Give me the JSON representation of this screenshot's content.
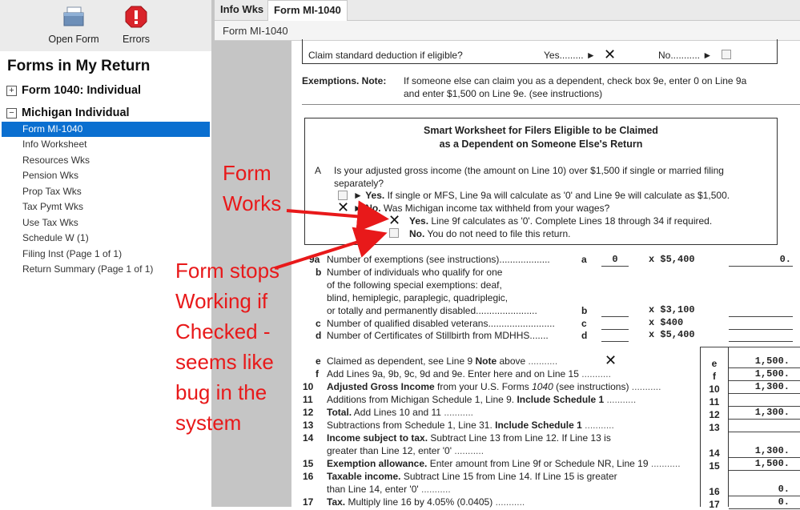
{
  "toolbar": {
    "open_form": "Open Form",
    "errors": "Errors"
  },
  "sidebar": {
    "title": "Forms in My Return",
    "groups": [
      {
        "label": "Form 1040:  Individual"
      },
      {
        "label": "Michigan Individual"
      }
    ],
    "items": [
      "Form MI-1040",
      "Info Worksheet",
      "Resources Wks",
      "Pension Wks",
      "Prop Tax Wks",
      "Tax Pymt Wks",
      "Use Tax Wks",
      "Schedule W (1)",
      "Filing Inst (Page 1 of 1)",
      "Return Summary (Page 1 of 1)"
    ]
  },
  "tabs": [
    "Info Wks",
    "Form MI-1040"
  ],
  "subtitle": "Form MI-1040",
  "form": {
    "std_ded": {
      "label": "Claim standard deduction if eligible?",
      "yes": "Yes",
      "no": "No"
    },
    "exemptions": {
      "head": "Exemptions. Note:",
      "line1": "If someone else can claim you as a dependent, check box 9e, enter 0 on Line 9a",
      "line2": "and enter $1,500 on Line 9e. (see instructions)"
    },
    "smart": {
      "title1": "Smart Worksheet for Filers Eligible to be Claimed",
      "title2": "as a Dependent on Someone Else's Return",
      "a": "A",
      "q1": "Is your adjusted gross income (the amount on Line 10) over $1,500 if single or married filing",
      "q2": "separately?",
      "yes_label": "Yes.",
      "yes_text": "If single or MFS, Line 9a will calculate as '0' and Line 9e will calculate as $1,500.",
      "no_label": "No.",
      "no_text": "Was Michigan income tax withheld from your wages?",
      "sub_yes_label": "Yes.",
      "sub_yes_text": "Line 9f calculates as '0'. Complete Lines 18 through 34 if required.",
      "sub_no_label": "No.",
      "sub_no_text": "You do not need to file this return."
    },
    "l9a": {
      "num": "9a",
      "text": "Number of exemptions (see instructions)",
      "letter": "a",
      "count": "0",
      "mult": "x $5,400",
      "amount": "0."
    },
    "l9b": {
      "num": "b",
      "lines": [
        "Number of individuals who qualify for one",
        "of the following special exemptions: deaf,",
        "blind, hemiplegic, paraplegic, quadriplegic,",
        "or totally and permanently disabled"
      ],
      "letter": "b",
      "mult": "x $3,100"
    },
    "l9c": {
      "num": "c",
      "text": "Number of qualified disabled veterans",
      "letter": "c",
      "mult": "x   $400"
    },
    "l9d": {
      "num": "d",
      "text": "Number of Certificates of Stillbirth from MDHHS",
      "letter": "d",
      "mult": "x $5,400"
    },
    "rows": [
      {
        "num": "e",
        "html": "Claimed as dependent, see Line 9 <b>Note</b> above",
        "code": "e",
        "amount": "1,500."
      },
      {
        "num": "f",
        "html": "Add Lines 9a, 9b, 9c, 9d and 9e. Enter here and on Line 15",
        "code": "f",
        "amount": "1,500."
      },
      {
        "num": "10",
        "html": "<b>Adjusted Gross Income</b> from your U.S. Forms <i>1040</i> (see instructions)",
        "code": "10",
        "amount": "1,300."
      },
      {
        "num": "11",
        "html": "Additions from Michigan Schedule 1, Line 9. <b>Include Schedule 1</b>",
        "code": "11",
        "amount": ""
      },
      {
        "num": "12",
        "html": "<b>Total.</b> Add Lines 10 and 11",
        "code": "12",
        "amount": "1,300."
      },
      {
        "num": "13",
        "html": "Subtractions from Schedule 1, Line 31. <b>Include Schedule 1</b>",
        "code": "13",
        "amount": ""
      },
      {
        "num": "14",
        "html": "<b>Income subject to tax.</b> Subtract Line 13 from Line 12. If Line 13 is",
        "code": "",
        "amount": ""
      },
      {
        "num": "",
        "html": "greater than Line 12, enter '0'",
        "code": "14",
        "amount": "1,300."
      },
      {
        "num": "15",
        "html": "<b>Exemption allowance.</b> Enter amount from Line 9f or Schedule NR, Line 19",
        "code": "15",
        "amount": "1,500."
      },
      {
        "num": "16",
        "html": "<b>Taxable income.</b> Subtract Line 15 from Line 14. If Line 15 is greater",
        "code": "",
        "amount": ""
      },
      {
        "num": "",
        "html": "than Line 14, enter '0'",
        "code": "16",
        "amount": "0."
      },
      {
        "num": "17",
        "html": "<b>Tax.</b> Multiply line 16 by 4.05% (0.0405)",
        "code": "17",
        "amount": "0."
      }
    ]
  },
  "annotations": {
    "works": [
      "Form",
      "Works"
    ],
    "stops": [
      "Form stops",
      "Working if",
      "Checked -",
      "seems like",
      "bug in the",
      "system"
    ],
    "color": "#e8191a"
  }
}
